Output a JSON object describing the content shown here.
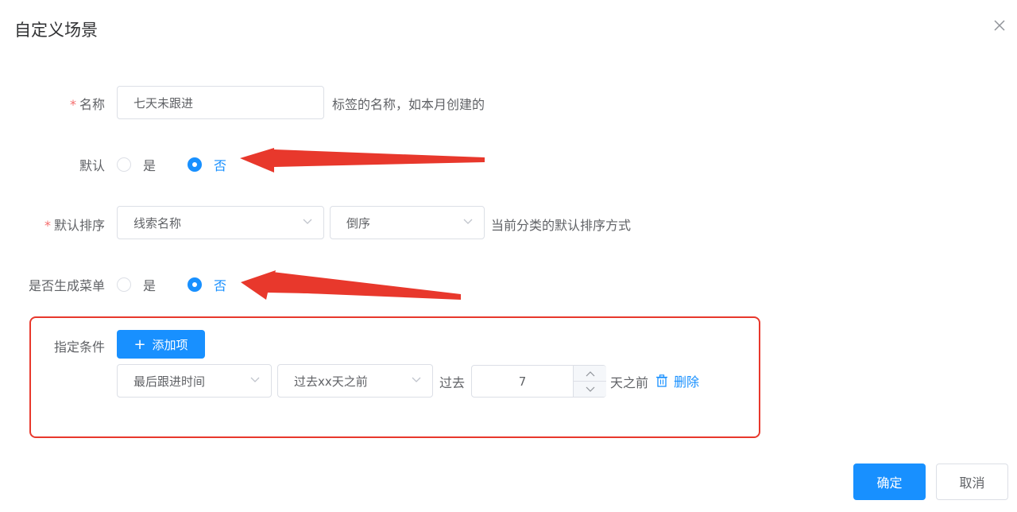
{
  "dialog": {
    "title": "自定义场景"
  },
  "form": {
    "name": {
      "label": "名称",
      "required_mark": "*",
      "value": "七天未跟进",
      "hint": "标签的名称，如本月创建的"
    },
    "default": {
      "label": "默认",
      "options": [
        "是",
        "否"
      ],
      "selected": "否"
    },
    "default_sort": {
      "label": "默认排序",
      "required_mark": "*",
      "field_value": "线索名称",
      "order_value": "倒序",
      "hint": "当前分类的默认排序方式"
    },
    "generate_menu": {
      "label": "是否生成菜单",
      "options": [
        "是",
        "否"
      ],
      "selected": "否"
    },
    "conditions": {
      "label": "指定条件",
      "add_button": "添加项",
      "row": {
        "field_value": "最后跟进时间",
        "operator_value": "过去xx天之前",
        "prefix": "过去",
        "number_value": "7",
        "suffix": "天之前",
        "delete_label": "删除"
      }
    }
  },
  "footer": {
    "confirm_label": "确定",
    "cancel_label": "取消"
  },
  "colors": {
    "primary": "#1890ff",
    "annotation_red": "#e8382c",
    "required": "#f56c6c"
  },
  "icons": {
    "close": "close-icon",
    "dropdown": "chevron-down-icon",
    "add": "plus-icon",
    "delete": "trash-icon",
    "stepper_up": "chevron-up-icon",
    "stepper_down": "chevron-down-icon"
  }
}
